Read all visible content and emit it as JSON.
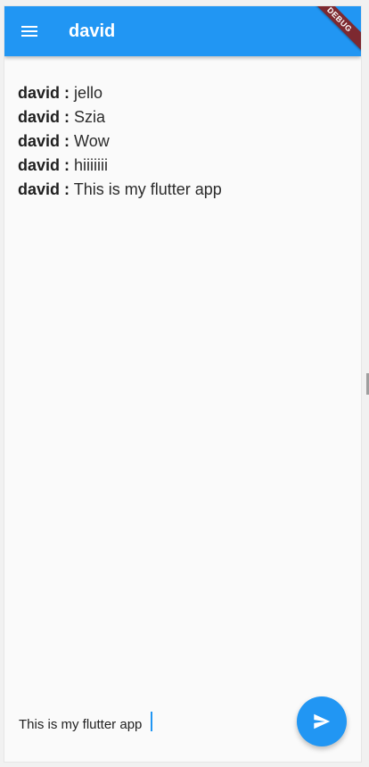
{
  "app_bar": {
    "title": "david",
    "debug_banner": "DEBUG",
    "color": "#2196F3"
  },
  "messages": [
    {
      "author": "david :",
      "text": "jello"
    },
    {
      "author": "david :",
      "text": "Szia"
    },
    {
      "author": "david :",
      "text": "Wow"
    },
    {
      "author": "david :",
      "text": "hiiiiiii"
    },
    {
      "author": "david :",
      "text": "This is my flutter app"
    }
  ],
  "composer": {
    "value": "This is my flutter app",
    "send_icon": "send-icon"
  },
  "icons": {
    "menu": "menu-icon",
    "send": "send-icon"
  }
}
